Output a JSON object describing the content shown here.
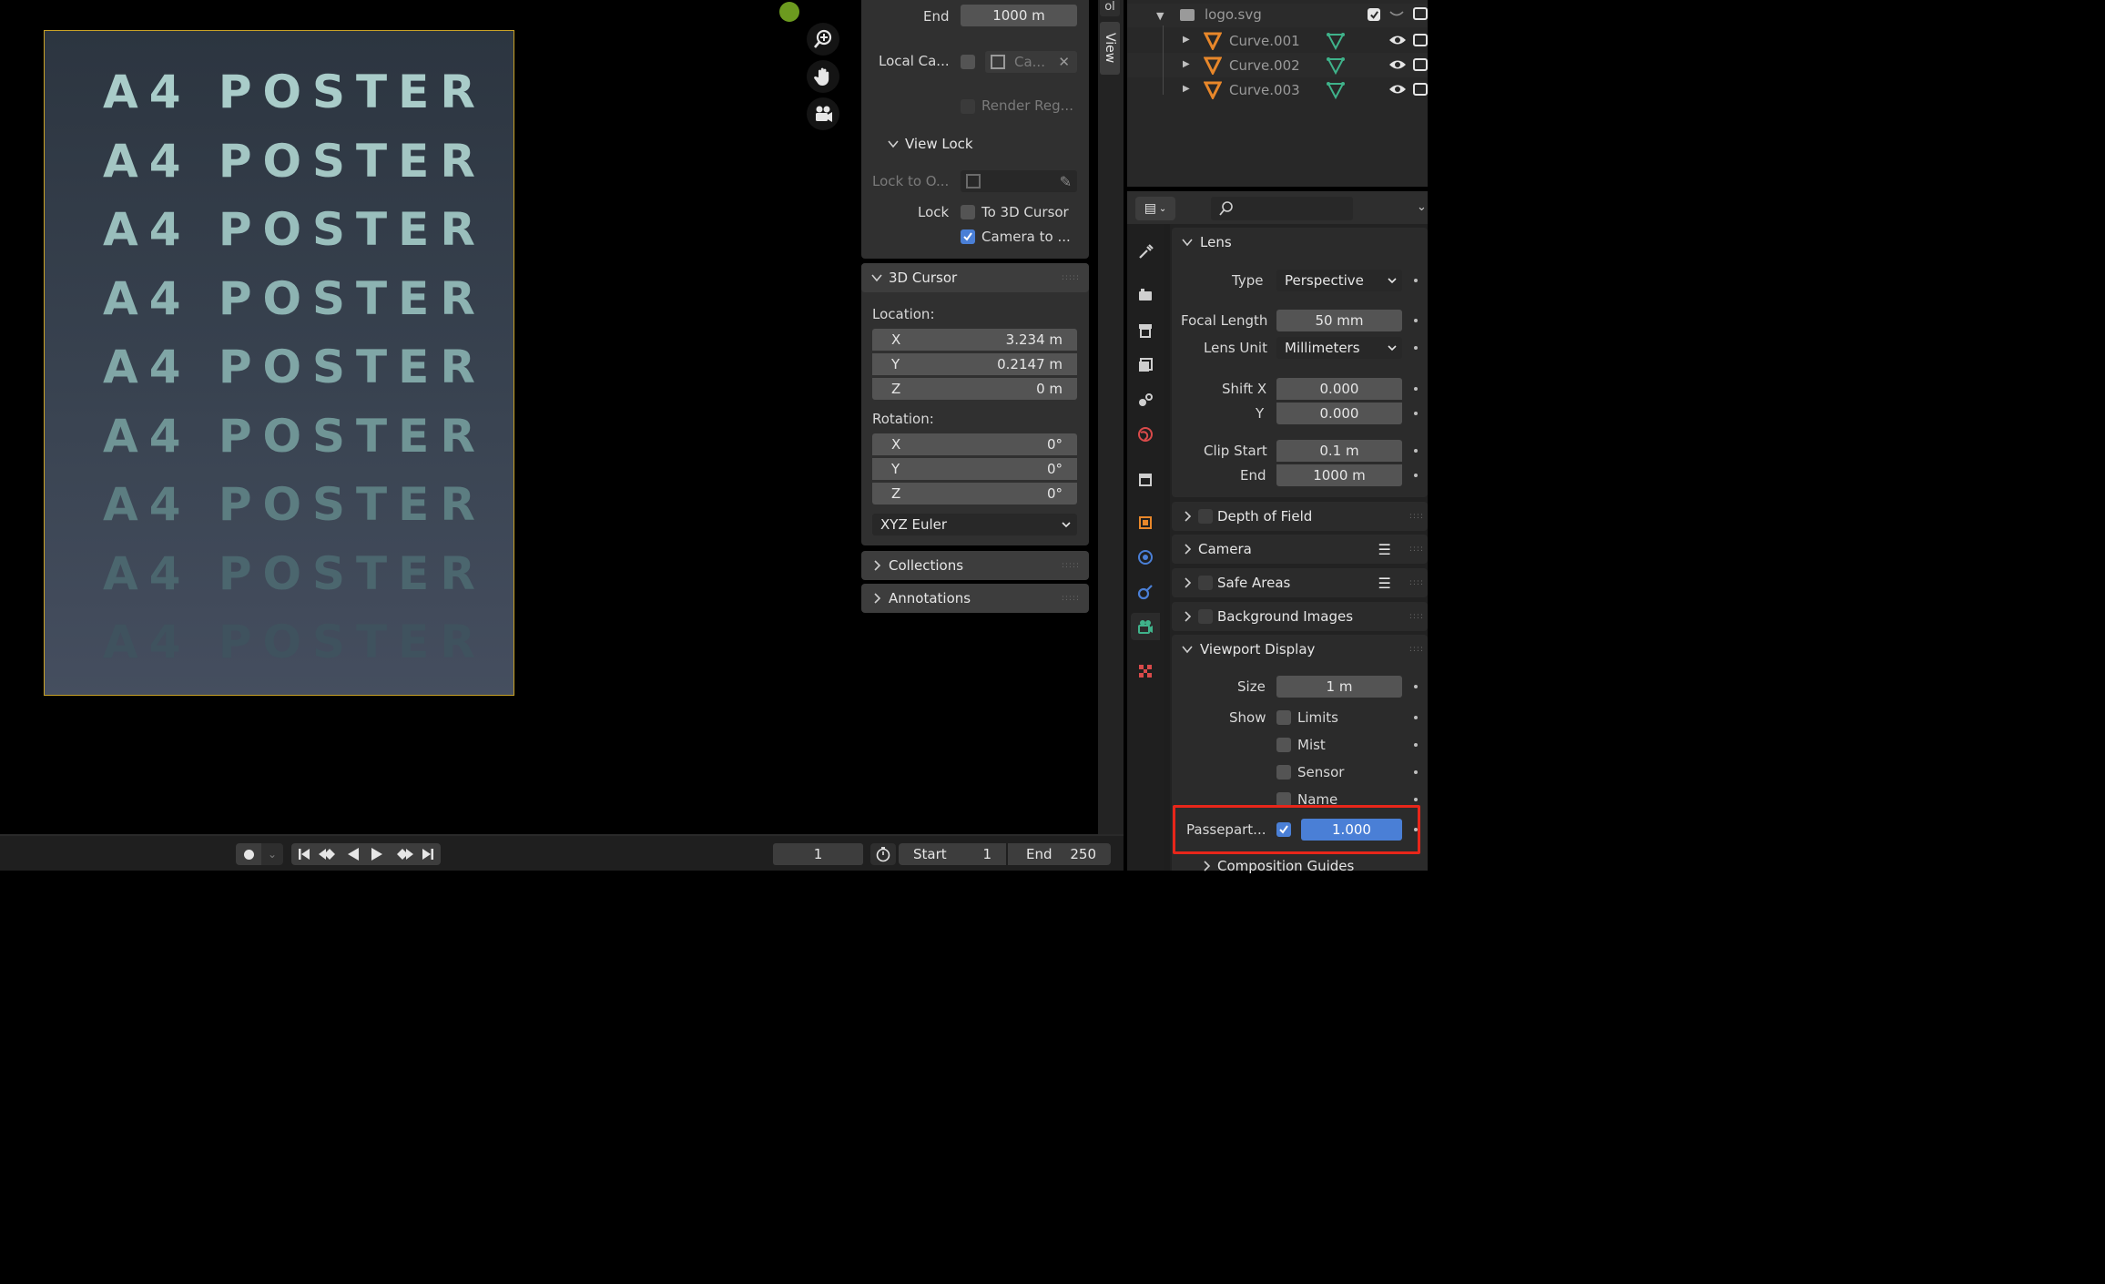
{
  "poster": {
    "lines": [
      "A4 POSTER",
      "A4 POSTER",
      "A4 POSTER",
      "A4 POSTER",
      "A4 POSTER",
      "A4 POSTER",
      "A4 POSTER",
      "A4 POSTER",
      "A4 POSTER"
    ],
    "colors": [
      "#a9ccc9",
      "#a3c6c3",
      "#99bebc",
      "#8db3b2",
      "#80a6a6",
      "#6f9495",
      "#5c7d81",
      "#4b666e",
      "#3f525e"
    ]
  },
  "view_tab": {
    "label": "View",
    "partial_label": "ol"
  },
  "npanel": {
    "clip_end_label": "End",
    "clip_end_value": "1000 m",
    "local_camera_label": "Local Ca...",
    "local_camera_value": "Ca...",
    "render_region_label": "Render Reg...",
    "view_lock_header": "View Lock",
    "lock_to_object_label": "Lock to O...",
    "lock_label": "Lock",
    "to_3d_cursor_label": "To 3D Cursor",
    "camera_to_view_label": "Camera to ...",
    "cursor_header": "3D Cursor",
    "location_label": "Location:",
    "loc": [
      {
        "axis": "X",
        "value": "3.234 m"
      },
      {
        "axis": "Y",
        "value": "0.2147 m"
      },
      {
        "axis": "Z",
        "value": "0 m"
      }
    ],
    "rotation_label": "Rotation:",
    "rot": [
      {
        "axis": "X",
        "value": "0°"
      },
      {
        "axis": "Y",
        "value": "0°"
      },
      {
        "axis": "Z",
        "value": "0°"
      }
    ],
    "rotation_mode": "XYZ Euler",
    "collections_header": "Collections",
    "annotations_header": "Annotations"
  },
  "outliner": {
    "root": "logo.svg",
    "items": [
      "Curve.001",
      "Curve.002",
      "Curve.003"
    ]
  },
  "properties": {
    "lens_header": "Lens",
    "type_label": "Type",
    "type_value": "Perspective",
    "focal_label": "Focal Length",
    "focal_value": "50 mm",
    "lens_unit_label": "Lens Unit",
    "lens_unit_value": "Millimeters",
    "shift_x_label": "Shift X",
    "shift_x_value": "0.000",
    "shift_y_label": "Y",
    "shift_y_value": "0.000",
    "clip_start_label": "Clip Start",
    "clip_start_value": "0.1 m",
    "clip_end_label": "End",
    "clip_end_value": "1000 m",
    "dof_header": "Depth of Field",
    "camera_header": "Camera",
    "safe_areas_header": "Safe Areas",
    "bg_images_header": "Background Images",
    "viewport_display_header": "Viewport Display",
    "size_label": "Size",
    "size_value": "1 m",
    "show_label": "Show",
    "show_limits": "Limits",
    "show_mist": "Mist",
    "show_sensor": "Sensor",
    "show_name": "Name",
    "passepartout_label": "Passepart...",
    "passepartout_value": "1.000",
    "composition_header": "Composition Guides",
    "highlight_color": "#e8261a"
  },
  "timeline": {
    "current_frame": "1",
    "start_label": "Start",
    "start_value": "1",
    "end_label": "End",
    "end_value": "250"
  }
}
